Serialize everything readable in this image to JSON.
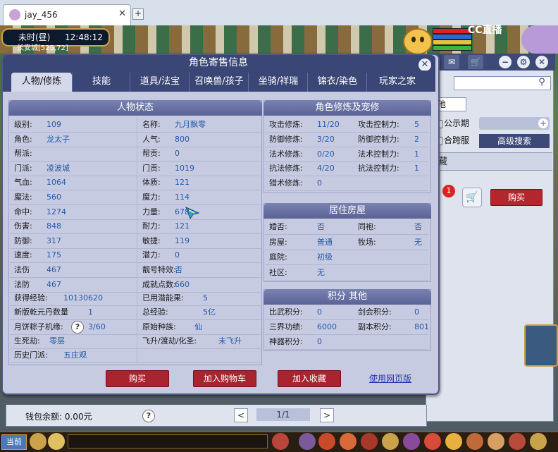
{
  "browser": {
    "tab_title": "jay_456",
    "tab_close": "✕",
    "new_tab": "+"
  },
  "game_hud": {
    "time_of_day": "未时(昼)",
    "clock": "12:48:12",
    "location": "长安城[525,72]",
    "stream_logo": "CC直播"
  },
  "dialog": {
    "title": "角色寄售信息",
    "close": "✕",
    "tabs": [
      "人物/修炼",
      "技能",
      "道具/法宝",
      "召唤兽/孩子",
      "坐骑/祥瑞",
      "锦衣/染色",
      "玩家之家"
    ],
    "active_tab": 0
  },
  "char_status": {
    "header": "人物状态",
    "left": [
      {
        "label": "级别:",
        "value": "109"
      },
      {
        "label": "角色:",
        "value": "龙太子"
      },
      {
        "label": "帮派:",
        "value": ""
      },
      {
        "label": "门派:",
        "value": "凌波城"
      },
      {
        "label": "气血:",
        "value": "1064"
      },
      {
        "label": "魔法:",
        "value": "560"
      },
      {
        "label": "命中:",
        "value": "1274"
      },
      {
        "label": "伤害:",
        "value": "848"
      },
      {
        "label": "防御:",
        "value": "317"
      },
      {
        "label": "速度:",
        "value": "175"
      },
      {
        "label": "法伤",
        "value": "467"
      },
      {
        "label": "法防",
        "value": "467"
      }
    ],
    "right": [
      {
        "label": "名称:",
        "value": "九月飘零"
      },
      {
        "label": "人气:",
        "value": "800"
      },
      {
        "label": "帮贡:",
        "value": "0"
      },
      {
        "label": "门贡:",
        "value": "1019"
      },
      {
        "label": "体质:",
        "value": "121"
      },
      {
        "label": "魔力:",
        "value": "114"
      },
      {
        "label": "力量:",
        "value": "678"
      },
      {
        "label": "耐力:",
        "value": "121"
      },
      {
        "label": "敏捷:",
        "value": "119"
      },
      {
        "label": "潜力:",
        "value": "0"
      },
      {
        "label": "靓号特效:",
        "value": "否"
      },
      {
        "label": "成就点数:",
        "value": "660"
      }
    ],
    "extra": [
      {
        "label": "获得经验:",
        "value": "10130620",
        "label2": "已用潜能果:",
        "value2": "5"
      },
      {
        "label": "新版乾元丹数量",
        "value": "1",
        "label2": "总经验:",
        "value2": "5亿"
      },
      {
        "label": "月饼粽子机缘:",
        "value": "3/60",
        "label2": "原始种族:",
        "value2": "仙"
      },
      {
        "label": "生死劫:",
        "value": "零层",
        "label2": "飞升/渡劫/化圣:",
        "value2": "未飞升"
      },
      {
        "label": "历史门派:",
        "value": "五庄观"
      }
    ],
    "help": "?"
  },
  "cultivation": {
    "header": "角色修炼及宠修",
    "rows": [
      {
        "label": "攻击修炼:",
        "value": "11/20",
        "label2": "攻击控制力:",
        "value2": "5"
      },
      {
        "label": "防御修炼:",
        "value": "3/20",
        "label2": "防御控制力:",
        "value2": "2"
      },
      {
        "label": "法术修炼:",
        "value": "0/20",
        "label2": "法术控制力:",
        "value2": "1"
      },
      {
        "label": "抗法修炼:",
        "value": "4/20",
        "label2": "抗法控制力:",
        "value2": "1"
      },
      {
        "label": "猎术修炼:",
        "value": "0"
      }
    ]
  },
  "housing": {
    "header": "居住房屋",
    "rows": [
      {
        "label": "婚否:",
        "value": "否",
        "label2": "同袍:",
        "value2": "否"
      },
      {
        "label": "房屋:",
        "value": "普通",
        "label2": "牧场:",
        "value2": "无"
      },
      {
        "label": "庭院:",
        "value": "初级"
      },
      {
        "label": "社区:",
        "value": "无"
      }
    ]
  },
  "points": {
    "header": "积分 其他",
    "rows": [
      {
        "label": "比武积分:",
        "value": "0",
        "label2": "剑会积分:",
        "value2": "0"
      },
      {
        "label": "三界功绩:",
        "value": "6000",
        "label2": "副本积分:",
        "value2": "801"
      },
      {
        "label": "神器积分:",
        "value": "0"
      }
    ]
  },
  "dialog_buttons": {
    "buy": "购买",
    "add_cart": "加入购物车",
    "add_fav": "加入收藏",
    "web_version": "使用网页版"
  },
  "right_window": {
    "other": "他",
    "public_period": "公示期",
    "cross_server": "合跨服",
    "advanced_search": "高级搜索",
    "favorites": "藏",
    "badge_count": "1",
    "buy": "购买"
  },
  "bottom": {
    "wallet": "钱包余额: 0.00元",
    "help": "?",
    "prev": "<",
    "page": "1/1",
    "next": ">",
    "current": "当前"
  },
  "colors": {
    "header_bar": "#3a4675",
    "value_text": "#245aa6",
    "red_button": "#a9242e"
  }
}
